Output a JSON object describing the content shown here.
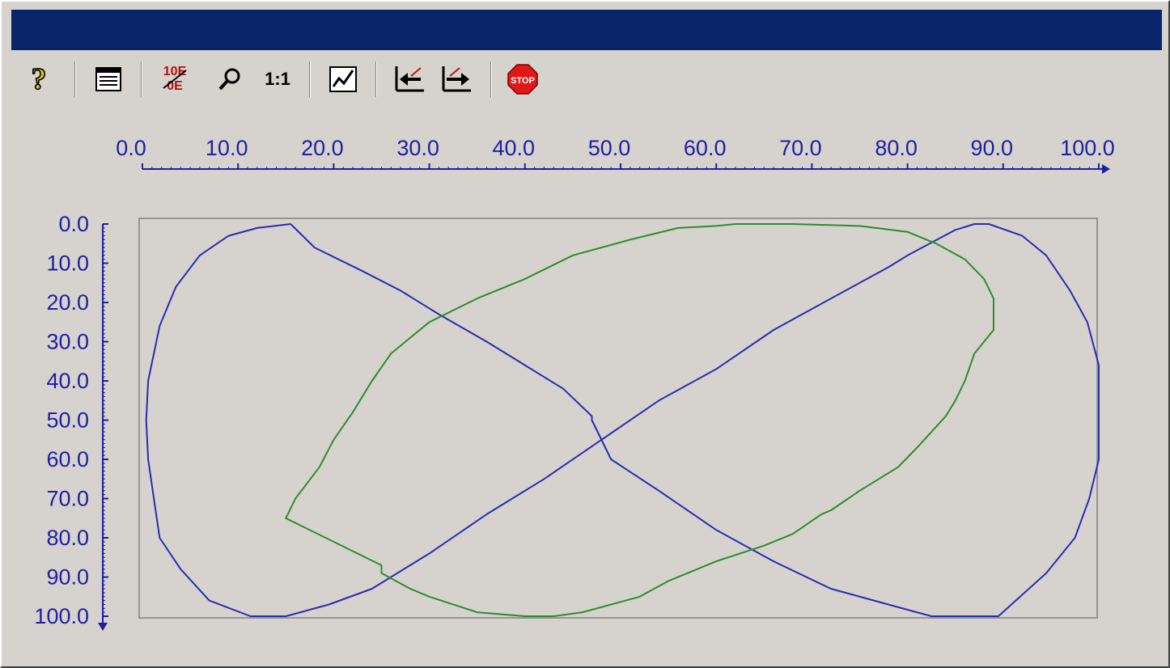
{
  "window": {
    "title": ""
  },
  "toolbar": {
    "buttons": [
      {
        "name": "help-button",
        "icon": "question-mark-icon"
      },
      {
        "name": "table-view-button",
        "icon": "table-icon"
      },
      {
        "name": "exponent-format-button",
        "icon": "exponent-icon",
        "text": "10E"
      },
      {
        "name": "zoom-button",
        "icon": "magnifier-icon"
      },
      {
        "name": "original-size-button",
        "icon": "one-to-one-icon",
        "text": "1:1"
      },
      {
        "name": "trend-button",
        "icon": "trend-chart-icon"
      },
      {
        "name": "scroll-back-button",
        "icon": "arrow-left-icon"
      },
      {
        "name": "scroll-forward-button",
        "icon": "arrow-right-icon"
      },
      {
        "name": "stop-button",
        "icon": "stop-sign-icon",
        "text": "STOP"
      }
    ]
  },
  "colors": {
    "axis": "#1f1fa0",
    "series_blue": "#2b2bb0",
    "series_green": "#2e8b2e",
    "frame": "#808080"
  },
  "chart_data": {
    "type": "line",
    "x_axis": {
      "position": "top",
      "range": [
        0,
        100
      ],
      "ticks": [
        "0.0",
        "10.0",
        "20.0",
        "30.0",
        "40.0",
        "50.0",
        "60.0",
        "70.0",
        "80.0",
        "90.0",
        "100.0"
      ]
    },
    "y_axis": {
      "position": "left",
      "direction": "down",
      "range": [
        0,
        100
      ],
      "ticks": [
        "0.0",
        "10.0",
        "20.0",
        "30.0",
        "40.0",
        "50.0",
        "60.0",
        "70.0",
        "80.0",
        "90.0",
        "100.0"
      ]
    },
    "series": [
      {
        "color": "series_blue",
        "points": [
          [
            15.5,
            0
          ],
          [
            12,
            1
          ],
          [
            9,
            3
          ],
          [
            6,
            8
          ],
          [
            3.5,
            16
          ],
          [
            1.8,
            26
          ],
          [
            0.6,
            40
          ],
          [
            0.4,
            50
          ],
          [
            0.6,
            60
          ],
          [
            1.8,
            80
          ],
          [
            4,
            88
          ],
          [
            7,
            96
          ],
          [
            11.3,
            100
          ],
          [
            15,
            100
          ],
          [
            19.5,
            97
          ],
          [
            24,
            93
          ],
          [
            30,
            84
          ],
          [
            36,
            74
          ],
          [
            42,
            65
          ],
          [
            48,
            55
          ],
          [
            54,
            45
          ],
          [
            60,
            37
          ],
          [
            66,
            27
          ],
          [
            72,
            19
          ],
          [
            78,
            11
          ],
          [
            80,
            8
          ],
          [
            85,
            1.5
          ],
          [
            87,
            0
          ],
          [
            88.5,
            0
          ],
          [
            92,
            3
          ],
          [
            94.5,
            8
          ],
          [
            97,
            17
          ],
          [
            98.8,
            25
          ],
          [
            100,
            36
          ],
          [
            100,
            60
          ],
          [
            99,
            70
          ],
          [
            97.5,
            80
          ],
          [
            94.5,
            89
          ],
          [
            89.5,
            100
          ],
          [
            82.5,
            100
          ],
          [
            78,
            97
          ],
          [
            72,
            93
          ],
          [
            66,
            86
          ],
          [
            60,
            78
          ],
          [
            54,
            68
          ],
          [
            49,
            60
          ],
          [
            47,
            50
          ],
          [
            47,
            49
          ],
          [
            44,
            42
          ],
          [
            40,
            36
          ],
          [
            36,
            30
          ],
          [
            31,
            23
          ],
          [
            27,
            17
          ],
          [
            23,
            12
          ],
          [
            18,
            6
          ],
          [
            15.5,
            0
          ]
        ]
      },
      {
        "color": "series_green",
        "points": [
          [
            62,
            0
          ],
          [
            60,
            0.5
          ],
          [
            56,
            1
          ],
          [
            51,
            4
          ],
          [
            45,
            8
          ],
          [
            40,
            14
          ],
          [
            35,
            19
          ],
          [
            30,
            25
          ],
          [
            26,
            33
          ],
          [
            24,
            40
          ],
          [
            22,
            48
          ],
          [
            20,
            55
          ],
          [
            18.5,
            62
          ],
          [
            16,
            70
          ],
          [
            15,
            75
          ],
          [
            25,
            87
          ],
          [
            25,
            89
          ],
          [
            28,
            93
          ],
          [
            30,
            95
          ],
          [
            35,
            99
          ],
          [
            40,
            100
          ],
          [
            43,
            100
          ],
          [
            46,
            99
          ],
          [
            49,
            97
          ],
          [
            52,
            95
          ],
          [
            55,
            91
          ],
          [
            60,
            86
          ],
          [
            65,
            82
          ],
          [
            68,
            79
          ],
          [
            71,
            74
          ],
          [
            72,
            73
          ],
          [
            75,
            68
          ],
          [
            79,
            62
          ],
          [
            81,
            57
          ],
          [
            84,
            49
          ],
          [
            85,
            45
          ],
          [
            86,
            40
          ],
          [
            87,
            33
          ],
          [
            89,
            27
          ],
          [
            89,
            19
          ],
          [
            88,
            14
          ],
          [
            86,
            9
          ],
          [
            83,
            5
          ],
          [
            80,
            2
          ],
          [
            75,
            0.5
          ],
          [
            68,
            0
          ],
          [
            62,
            0
          ]
        ]
      }
    ]
  }
}
